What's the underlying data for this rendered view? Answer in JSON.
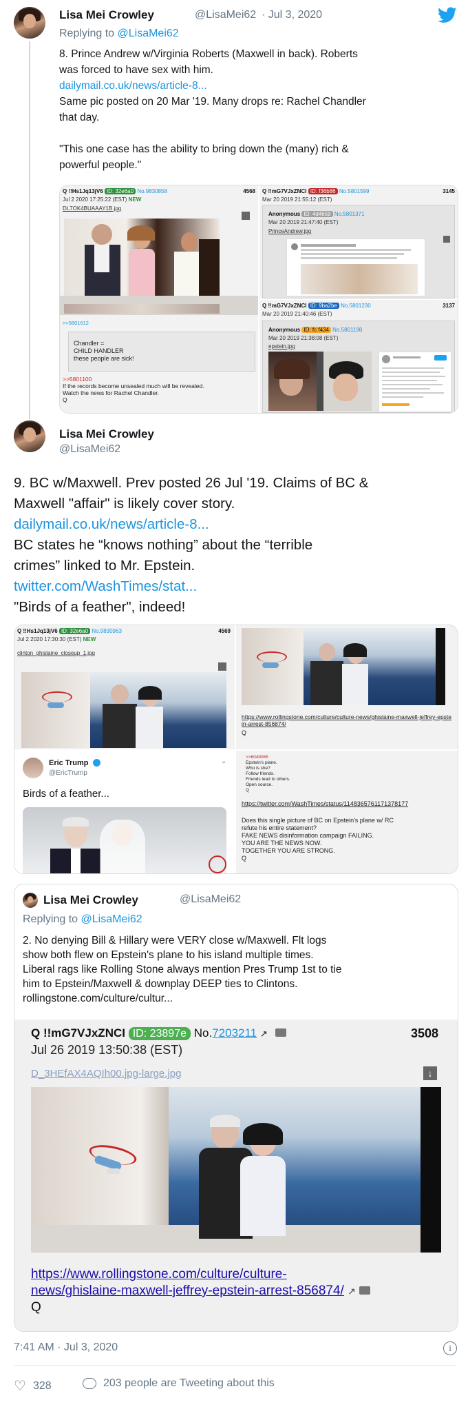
{
  "tweet1": {
    "name": "Lisa Mei Crowley",
    "handle": "@LisaMei62",
    "date": "· Jul 3, 2020",
    "replying_prefix": "Replying to ",
    "replying_handle": "@LisaMei62",
    "line1": "8. Prince Andrew w/Virginia Roberts (Maxwell in back). Roberts",
    "line2": "was forced to have sex with him.",
    "link1": "dailymail.co.uk/news/article-8...",
    "line3": "Same pic posted on 20 Mar '19. Many drops re: Rachel Chandler",
    "line4": "that day.",
    "quote1": "\"This one case has the ability to bring down the (many) rich &",
    "quote2": "powerful people.\"",
    "posts": {
      "left": {
        "header": "Q !!Hs1Jq13jV6",
        "id": "ID: 32e6a0",
        "no": "No.9830858",
        "num": "4568",
        "date": "Jul 2 2020 17:25:22 (EST)",
        "new": "NEW",
        "file": "DL7OK4BUAAAY1B.jpg",
        "ref": ">>5801612",
        "t1": "Chandler =",
        "t2": "CHILD HANDLER",
        "t3": "these people are sick!",
        "ref2": ">>5801100",
        "t4": "If the records become unsealed much will be revealed.",
        "t5": "Watch the news for Rachel Chandler.",
        "q": "Q"
      },
      "right_top": {
        "header": "Q !!mG7VJxZNCI",
        "id": "ID: f36b86",
        "no": "No.5801599",
        "num": "3145",
        "date": "Mar 20 2019 21:55:12 (EST)",
        "anon": "Anonymous",
        "anon_id": "ID: 4d4659",
        "anon_no": "No.5801371",
        "anon_date": "Mar 20 2019 21:47:40 (EST)",
        "file": "PrinceAndrew.jpg"
      },
      "right_bottom": {
        "header": "Q !!mG7VJxZNCI",
        "id": "ID: 9ba2be",
        "no": "No.5801230",
        "num": "3137",
        "date": "Mar 20 2019 21:40:46 (EST)",
        "anon": "Anonymous",
        "anon_id": "ID: fc f434",
        "anon_no": "No.5801198",
        "anon_date": "Mar 20 2019 21:38:08 (EST)",
        "file": "epstein.jpg"
      }
    }
  },
  "tweet2": {
    "name": "Lisa Mei Crowley",
    "handle": "@LisaMei62",
    "line1": "9. BC w/Maxwell. Prev posted 26 Jul '19. Claims of BC &",
    "line2": "Maxwell \"affair\" is likely cover story.",
    "link1": "dailymail.co.uk/news/article-8...",
    "line3": "BC states he  “knows nothing”  about the  “terrible",
    "line4": "crimes”  linked to Mr. Epstein.",
    "link2": "twitter.com/WashTimes/stat...",
    "line5": "\"Birds of a feather\", indeed!",
    "posts": {
      "left_top": {
        "header": "Q !!Hs1Jq13jV6",
        "id": "ID: 32e6a0",
        "no": "No.9830963",
        "num": "4569",
        "date": "Jul 2 2020 17:30:30 (EST)",
        "new": "NEW",
        "file": "clinton_ghislaine_closeup_1.jpg"
      },
      "left_bottom": {
        "et_name": "Eric Trump",
        "et_handle": "@EricTrump",
        "et_text": "Birds of a feather..."
      },
      "right_top": {
        "link": "https://www.rollingstone.com/culture/culture-news/ghislaine-maxwell-jeffrey-epstein-arrest-856874/",
        "q": "Q"
      },
      "right_bottom": {
        "ref": ">>6049065",
        "s1": "Epstein's plane.",
        "s2": "Who is she?",
        "s3": "Follow friends.",
        "s4": "Friends lead to others.",
        "s5": "Open source.",
        "s6": "Q",
        "link": "https://twitter.com/WashTimes/status/1148365761171378177",
        "t1": "Does this single picture of BC on Epstein's plane w/ RC",
        "t2": "refute his entire statement?",
        "t3": "FAKE NEWS disinformation campaign FAILING.",
        "t4": "YOU ARE THE NEWS NOW.",
        "t5": "TOGETHER YOU ARE STRONG.",
        "t6": "Q"
      }
    }
  },
  "quoted": {
    "name": "Lisa Mei Crowley",
    "handle": "@LisaMei62",
    "replying_prefix": "Replying to ",
    "replying_handle": "@LisaMei62",
    "line1": "2. No denying Bill & Hillary were VERY close w/Maxwell. Flt logs",
    "line2": "show both flew on Epstein's plane to his island multiple times.",
    "line3": "Liberal rags like Rolling Stone always mention Pres Trump 1st to tie",
    "line4": "him to Epstein/Maxwell & downplay DEEP ties to Clintons.",
    "line5": "rollingstone.com/culture/cultur...",
    "post": {
      "header": "Q !!mG7VJxZNCI",
      "id": "ID: 23897e",
      "no_prefix": "No.",
      "no": "7203211",
      "num": "3508",
      "date": "Jul 26 2019 13:50:38 (EST)",
      "file": "D_3HEfAX4AQIh00.jpg-large.jpg",
      "link1": "https://www.rollingstone.com/culture/culture-",
      "link2": "news/ghislaine-maxwell-jeffrey-epstein-arrest-856874/",
      "q": "Q"
    }
  },
  "footer": {
    "time": "7:41 AM · Jul 3, 2020",
    "likes": "328",
    "tweeting": "203 people are Tweeting about this"
  },
  "colors": {
    "accent": "#1b95e0",
    "twitter_blue": "#1da1f2",
    "id_green": "#2c8f3a",
    "id_red": "#c62828"
  }
}
